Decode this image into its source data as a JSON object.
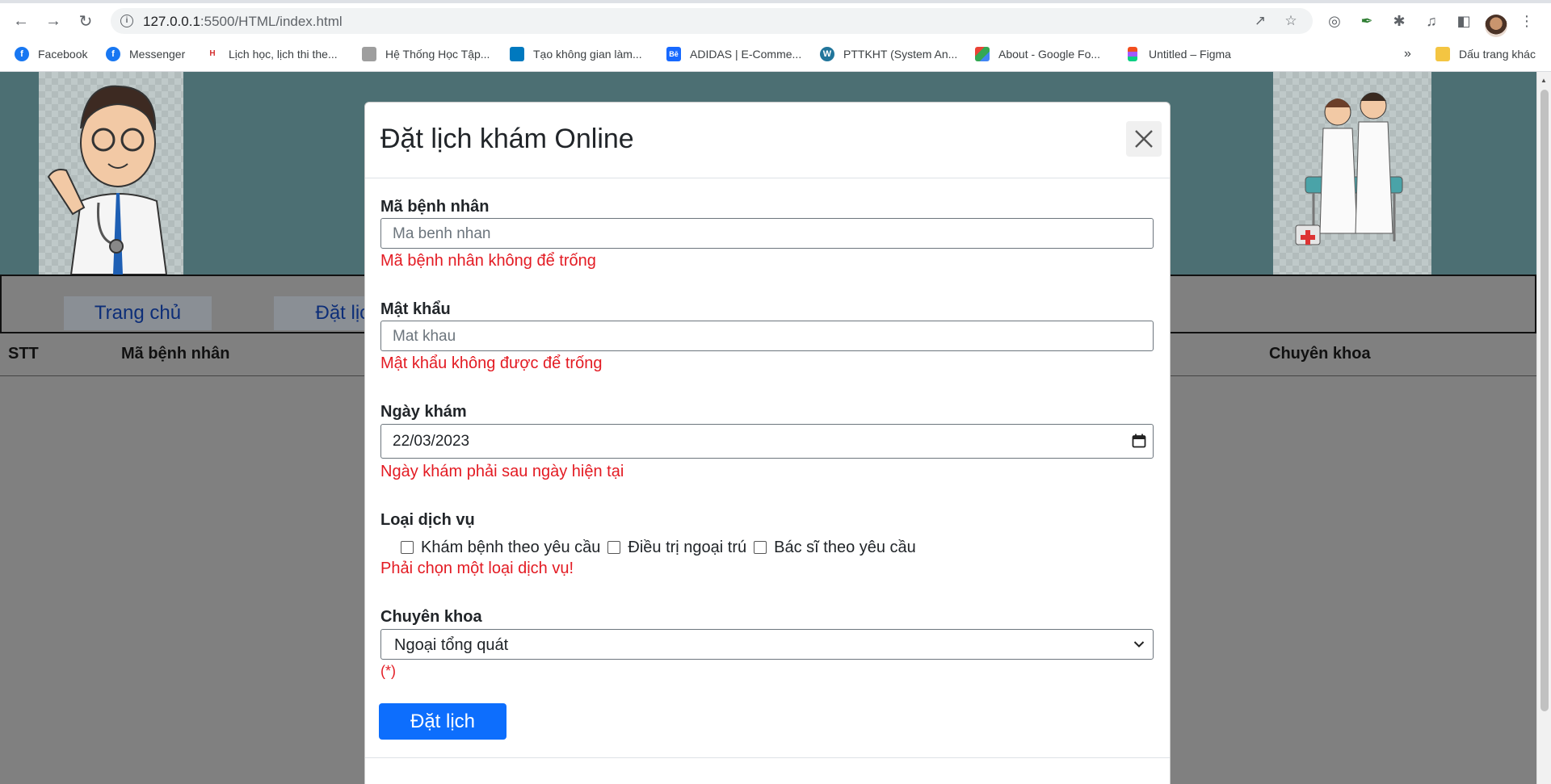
{
  "browser": {
    "url_host": "127.0.0.1",
    "url_path": ":5500/HTML/index.html",
    "bookmarks": [
      {
        "label": "Facebook",
        "icon": "facebook-icon",
        "color": "#1877f2"
      },
      {
        "label": "Messenger",
        "icon": "facebook-icon",
        "color": "#1877f2"
      },
      {
        "label": "Lịch học, lịch thi the...",
        "icon": "site-icon",
        "color": "#d32f2f"
      },
      {
        "label": "Hệ Thống Học Tập...",
        "icon": "site-icon",
        "color": "#757575"
      },
      {
        "label": "Tạo không gian làm...",
        "icon": "trello-icon",
        "color": "#0079bf"
      },
      {
        "label": "ADIDAS | E-Comme...",
        "icon": "behance-icon",
        "color": "#1769ff"
      },
      {
        "label": "PTTKHT (System An...",
        "icon": "wordpress-icon",
        "color": "#21759b"
      },
      {
        "label": "About - Google Fo...",
        "icon": "google-forms-icon",
        "color": "#673ab7"
      },
      {
        "label": "Untitled – Figma",
        "icon": "figma-icon",
        "color": "#f24e1e"
      }
    ],
    "more_bookmarks": "»",
    "other_bookmarks": "Dấu trang khác"
  },
  "page": {
    "nav": [
      "Trang chủ",
      "Đặt lịch"
    ],
    "table_headers": {
      "stt": "STT",
      "ma_benh_nhan": "Mã bệnh nhân",
      "chuyen_khoa": "Chuyên khoa"
    }
  },
  "modal": {
    "title": "Đặt lịch khám Online",
    "patient_id": {
      "label": "Mã bệnh nhân",
      "placeholder": "Ma benh nhan",
      "error": "Mã bệnh nhân không để trống"
    },
    "password": {
      "label": "Mật khẩu",
      "placeholder": "Mat khau",
      "error": "Mật khẩu không được để trống"
    },
    "date": {
      "label": "Ngày khám",
      "value": "22/03/2023",
      "error": "Ngày khám phải sau ngày hiện tại"
    },
    "service": {
      "label": "Loại dịch vụ",
      "options": [
        "Khám bệnh theo yêu cầu",
        "Điều trị ngoại trú",
        "Bác sĩ theo yêu cầu"
      ],
      "error": "Phải chọn một loại dịch vụ!"
    },
    "specialty": {
      "label": "Chuyên khoa",
      "value": "Ngoại tổng quát",
      "note": "(*)"
    },
    "submit_label": "Đặt lịch"
  },
  "colors": {
    "error": "#e31b23",
    "primary": "#0d6efd",
    "banner": "#4c6f73",
    "overlay": "#808080"
  }
}
